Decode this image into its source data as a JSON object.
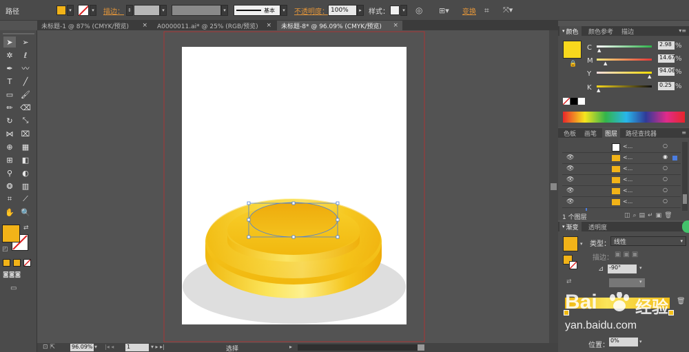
{
  "control_bar": {
    "object_type": "路径",
    "stroke_label": "描边：",
    "stroke_profile": "基本",
    "opacity_label": "不透明度：",
    "opacity_value": "100%",
    "style_label": "样式：",
    "transform_label": "变换",
    "fill_color": "#f2b318"
  },
  "document_tabs": [
    {
      "label": "未标题-1 @ 87% (CMYK/预览)",
      "close": "×"
    },
    {
      "label": "A0000011.ai* @ 25% (RGB/预览)",
      "close": "×"
    },
    {
      "label": "未标题-8* @ 96.09% (CMYK/预览)",
      "close": "×"
    }
  ],
  "status_bar": {
    "zoom": "96.09%",
    "artboard_number": "1",
    "tool_name": "选择"
  },
  "color_panel": {
    "tabs": [
      "颜色",
      "颜色参考",
      "描边"
    ],
    "channels": [
      {
        "name": "C",
        "value": "2.98",
        "slider": 0.03
      },
      {
        "name": "M",
        "value": "14.67",
        "slider": 0.15
      },
      {
        "name": "Y",
        "value": "94.06",
        "slider": 0.94
      },
      {
        "name": "K",
        "value": "0.25",
        "slider": 0.0
      }
    ],
    "swatch_color": "#f8d81d"
  },
  "layers_panel": {
    "tabs": [
      "色板",
      "画笔",
      "图层",
      "路径查找器"
    ],
    "active_tab": "图层",
    "row_label": "<...",
    "layer_count": "1 个图层"
  },
  "gradient_panel": {
    "tabs": [
      "渐变",
      "透明度"
    ],
    "type_label": "类型：",
    "type_value": "线性",
    "stroke_label": "描边：",
    "angle_value": "-90°",
    "position_label": "位置：",
    "position_value": "0%"
  },
  "watermark": {
    "brand": "Bai",
    "cn": "经验",
    "url": "yan.baidu.com"
  },
  "accent_colors": {
    "orange_link": "#e2953a",
    "gold": "#f2c21b",
    "shadow": "#dedede"
  }
}
